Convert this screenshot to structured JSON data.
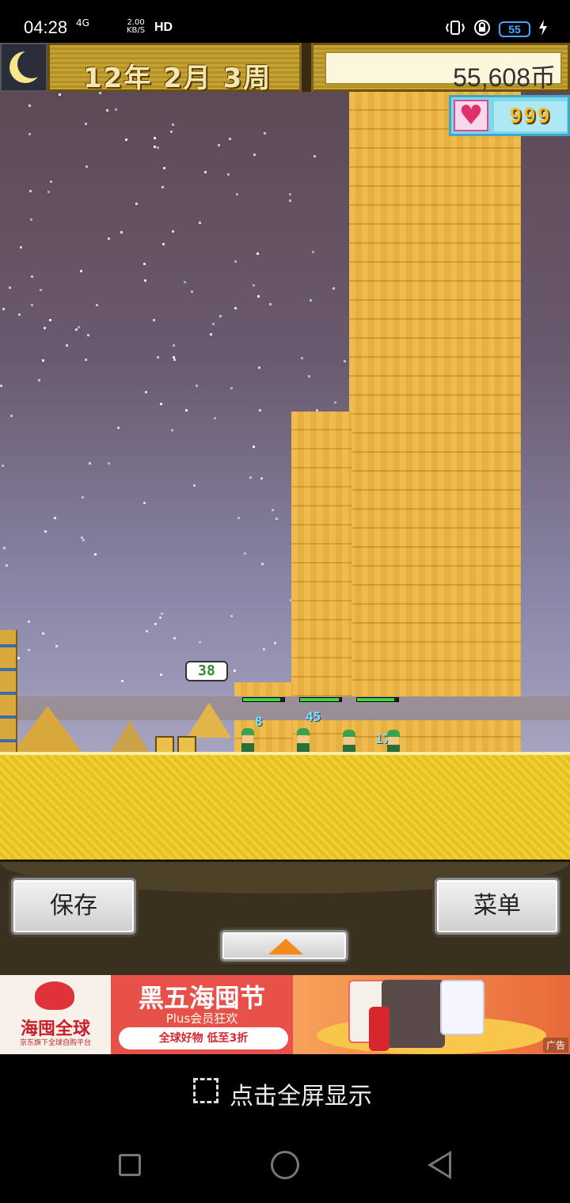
{
  "status_bar": {
    "time": "04:28",
    "network": "4G",
    "speed_value": "2.00",
    "speed_unit": "KB/S",
    "hd": "HD",
    "battery": "55",
    "icons": [
      "signal-icon",
      "wifi-icon",
      "vibrate-icon",
      "lock-rotation-icon",
      "battery-icon",
      "charging-icon"
    ]
  },
  "hud": {
    "date": "12年 2月 3周",
    "money": "55,608币",
    "hearts": "999",
    "icons": [
      "moon-icon",
      "heart-icon"
    ]
  },
  "scene": {
    "bubble_value": "38",
    "damage_numbers": [
      "8",
      "45",
      "17"
    ],
    "worker_hp": [
      0.9,
      0.95,
      0.9
    ]
  },
  "controls": {
    "save_label": "保存",
    "menu_label": "菜单",
    "up_icon": "up-arrow-icon"
  },
  "ad": {
    "logo": "海囤全球",
    "logo_sub": "京东旗下全球自购平台",
    "title": "黑五海囤节",
    "subtitle": "Plus会员狂欢",
    "pill": "全球好物 低至3折",
    "tag": "广告",
    "colors": {
      "primary": "#e8504a",
      "accent": "#d8262e"
    }
  },
  "fullscreen": {
    "label": "点击全屏显示",
    "icon": "expand-icon"
  },
  "navbar": {
    "icons": [
      "recent-apps-icon",
      "home-icon",
      "back-icon"
    ]
  }
}
